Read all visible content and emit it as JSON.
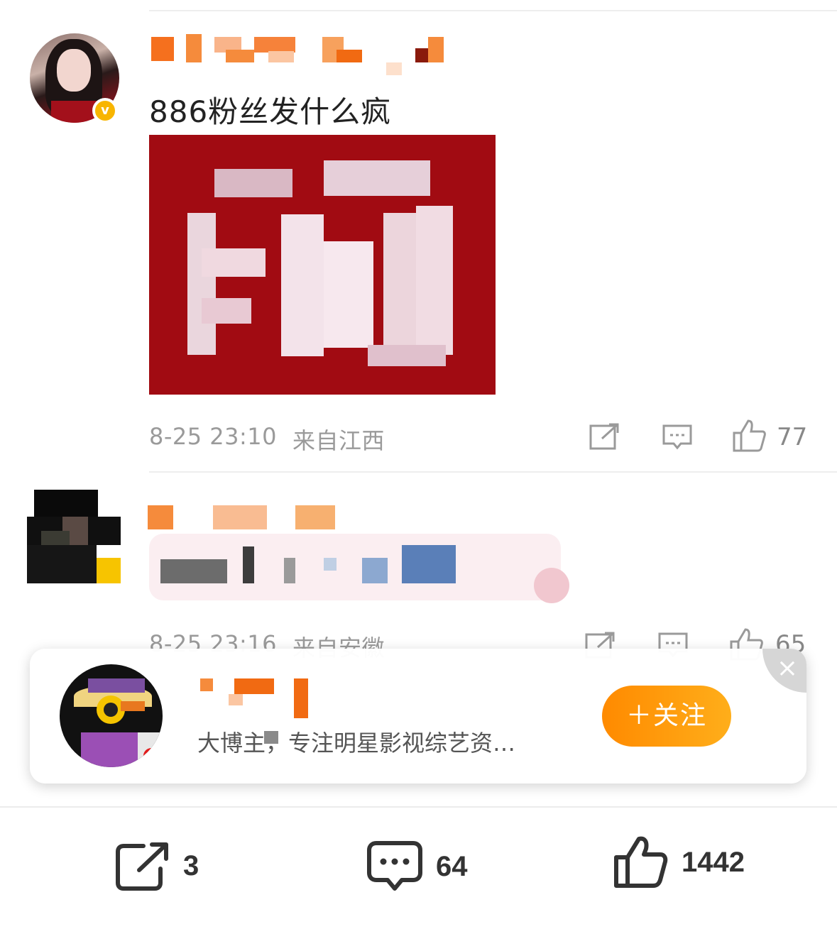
{
  "comment1": {
    "text": "886粉丝发什么疯",
    "timestamp": "8-25 23:10",
    "location": "来自江西",
    "like_count": "77",
    "icons": [
      "repost-icon",
      "comment-icon",
      "like-icon"
    ]
  },
  "comment2": {
    "timestamp": "8-25 23:16",
    "location": "来自安徽",
    "like_count": "65"
  },
  "follow_card": {
    "description": "大博主，专注明星影视综艺资…",
    "follow_label": "＋关注",
    "close_label": "×"
  },
  "bottom_bar": {
    "repost_count": "3",
    "comment_count": "64",
    "like_count": "1442"
  },
  "colors": {
    "accent_orange": "#ff8a00",
    "verified_badge": "#f8b500",
    "image_red": "#a10b12"
  }
}
